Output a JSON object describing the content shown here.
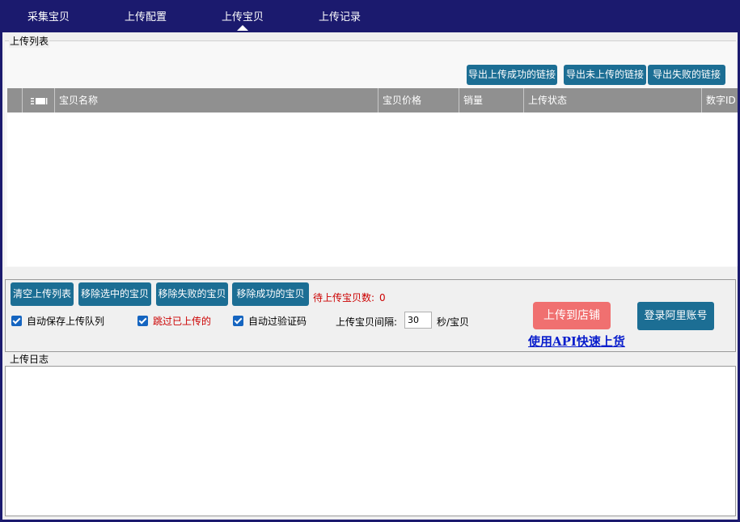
{
  "nav": {
    "tabs": [
      {
        "label": "采集宝贝"
      },
      {
        "label": "上传配置"
      },
      {
        "label": "上传宝贝",
        "active": true
      },
      {
        "label": "上传记录"
      }
    ]
  },
  "upload_list": {
    "title": "上传列表",
    "export_buttons": [
      "导出上传成功的链接",
      "导出未上传的链接",
      "导出失败的链接"
    ],
    "columns": [
      "",
      "宝贝名称",
      "宝贝价格",
      "销量",
      "上传状态",
      "数字ID"
    ],
    "rows": []
  },
  "actions": {
    "buttons": [
      "清空上传列表",
      "移除选中的宝贝",
      "移除失败的宝贝",
      "移除成功的宝贝"
    ],
    "pending_label": "待上传宝贝数:",
    "pending_count": "0",
    "options": [
      {
        "label": "自动保存上传队列",
        "checked": true
      },
      {
        "label": "跳过已上传的",
        "checked": true
      },
      {
        "label": "自动过验证码",
        "checked": true
      }
    ],
    "interval_label": "上传宝贝间隔:",
    "interval_value": "30",
    "interval_unit": "秒/宝贝",
    "upload_button": "上传到店铺",
    "login_button": "登录阿里账号",
    "api_link": "使用API快速上货"
  },
  "log": {
    "title": "上传日志",
    "content": ""
  },
  "colors": {
    "nav_bg": "#1b1a6e",
    "primary_button": "#1c6e94",
    "upload_button": "#f07070",
    "table_header": "#909090",
    "warning_text": "#cc0000",
    "link": "#0a1ecc"
  }
}
